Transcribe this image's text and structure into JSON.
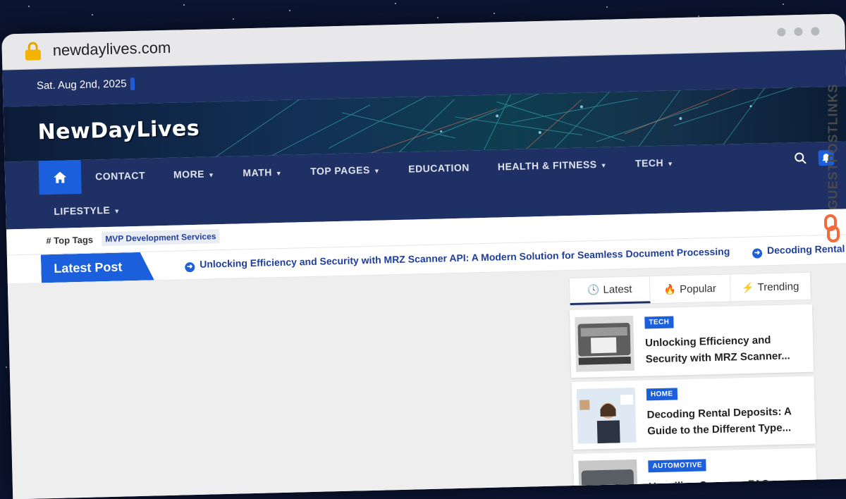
{
  "browser": {
    "url": "newdaylives.com"
  },
  "topbar": {
    "date": "Sat. Aug 2nd, 2025"
  },
  "site": {
    "logo": "NewDayLives"
  },
  "nav": {
    "items": [
      {
        "label": "CONTACT",
        "caret": false
      },
      {
        "label": "MORE",
        "caret": true
      },
      {
        "label": "MATH",
        "caret": true
      },
      {
        "label": "TOP PAGES",
        "caret": true
      },
      {
        "label": "EDUCATION",
        "caret": false
      },
      {
        "label": "HEALTH & FITNESS",
        "caret": true
      },
      {
        "label": "TECH",
        "caret": true
      }
    ],
    "second_row": {
      "label": "LIFESTYLE",
      "caret": true
    }
  },
  "tags": {
    "label": "Top Tags",
    "items": [
      "MVP Development Services"
    ]
  },
  "latest": {
    "label": "Latest Post",
    "ticker": [
      "Unlocking Efficiency and Security with MRZ Scanner API: A Modern Solution for Seamless Document Processing",
      "Decoding Rental Dep"
    ]
  },
  "sidebar": {
    "tabs": [
      {
        "label": "Latest",
        "icon": "clock-icon",
        "active": true
      },
      {
        "label": "Popular",
        "icon": "fire-icon",
        "active": false
      },
      {
        "label": "Trending",
        "icon": "bolt-icon",
        "active": false
      }
    ],
    "posts": [
      {
        "category": "TECH",
        "title": "Unlocking Efficiency and Security with MRZ Scanner..."
      },
      {
        "category": "HOME",
        "title": "Decoding Rental Deposits: A Guide to the Different Type..."
      },
      {
        "category": "AUTOMOTIVE",
        "title": "Unveiling Common FAQs"
      }
    ]
  },
  "watermark": {
    "text": "GUESTPOSTLINKS"
  },
  "colors": {
    "navy": "#1f3065",
    "accent": "#1b5fdc",
    "link": "#1f3f9a"
  }
}
